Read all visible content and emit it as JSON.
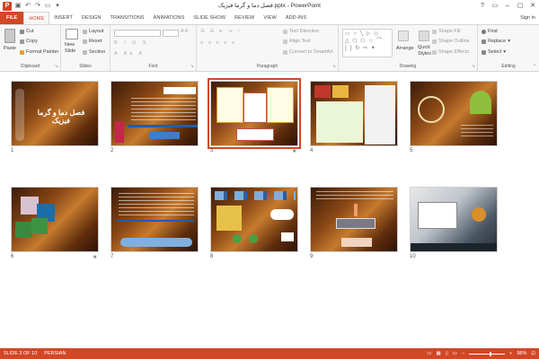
{
  "app": {
    "logo_letter": "P",
    "title": "فصل دما و گرما فیزیک.pptx - PowerPoint",
    "window_controls": [
      "?",
      "▭",
      "–",
      "▢",
      "✕"
    ]
  },
  "qat": {
    "save_icon": "save-icon",
    "undo_icon": "undo-icon",
    "redo_icon": "redo-icon",
    "present_icon": "start-slideshow-icon"
  },
  "tabs": [
    {
      "label": "FILE"
    },
    {
      "label": "HOME"
    },
    {
      "label": "INSERT"
    },
    {
      "label": "DESIGN"
    },
    {
      "label": "TRANSITIONS"
    },
    {
      "label": "ANIMATIONS"
    },
    {
      "label": "SLIDE SHOW"
    },
    {
      "label": "REVIEW"
    },
    {
      "label": "VIEW"
    },
    {
      "label": "ADD-INS"
    }
  ],
  "signin": "Sign in",
  "ribbon": {
    "clipboard": {
      "label": "Clipboard",
      "paste": "Paste",
      "cut": "Cut",
      "copy": "Copy",
      "format_painter": "Format Painter"
    },
    "slides": {
      "label": "Slides",
      "new_slide": "New",
      "new_slide2": "Slide",
      "layout": "Layout",
      "reset": "Reset",
      "section": "Section"
    },
    "font": {
      "label": "Font"
    },
    "paragraph": {
      "label": "Paragraph",
      "text_direction": "Text Direction",
      "align_text": "Align Text",
      "smartart": "Convert to SmartArt"
    },
    "drawing": {
      "label": "Drawing",
      "arrange": "Arrange",
      "quick_styles": "Quick",
      "quick_styles2": "Styles",
      "shape_fill": "Shape Fill",
      "shape_outline": "Shape Outline",
      "shape_effects": "Shape Effects"
    },
    "editing": {
      "label": "Editing",
      "find": "Find",
      "replace": "Replace",
      "select": "Select"
    }
  },
  "slides": [
    {
      "num": "1",
      "star": "",
      "title": "فصل دما و گرما فیزیک"
    },
    {
      "num": "2",
      "star": "",
      "title": ""
    },
    {
      "num": "3",
      "star": "★",
      "title": ""
    },
    {
      "num": "4",
      "star": "",
      "title": ""
    },
    {
      "num": "5",
      "star": "",
      "title": ""
    },
    {
      "num": "6",
      "star": "★",
      "title": ""
    },
    {
      "num": "7",
      "star": "",
      "title": ""
    },
    {
      "num": "8",
      "star": "",
      "title": ""
    },
    {
      "num": "9",
      "star": "",
      "title": ""
    },
    {
      "num": "10",
      "star": "",
      "title": ""
    }
  ],
  "status": {
    "slide_info": "SLIDE 3 OF 10",
    "language": "PERSIAN",
    "zoom": "98%",
    "zoom_fraction": 0.6
  },
  "colors": {
    "accent": "#d24726",
    "ribbon_bg": "#f7f7f7"
  }
}
